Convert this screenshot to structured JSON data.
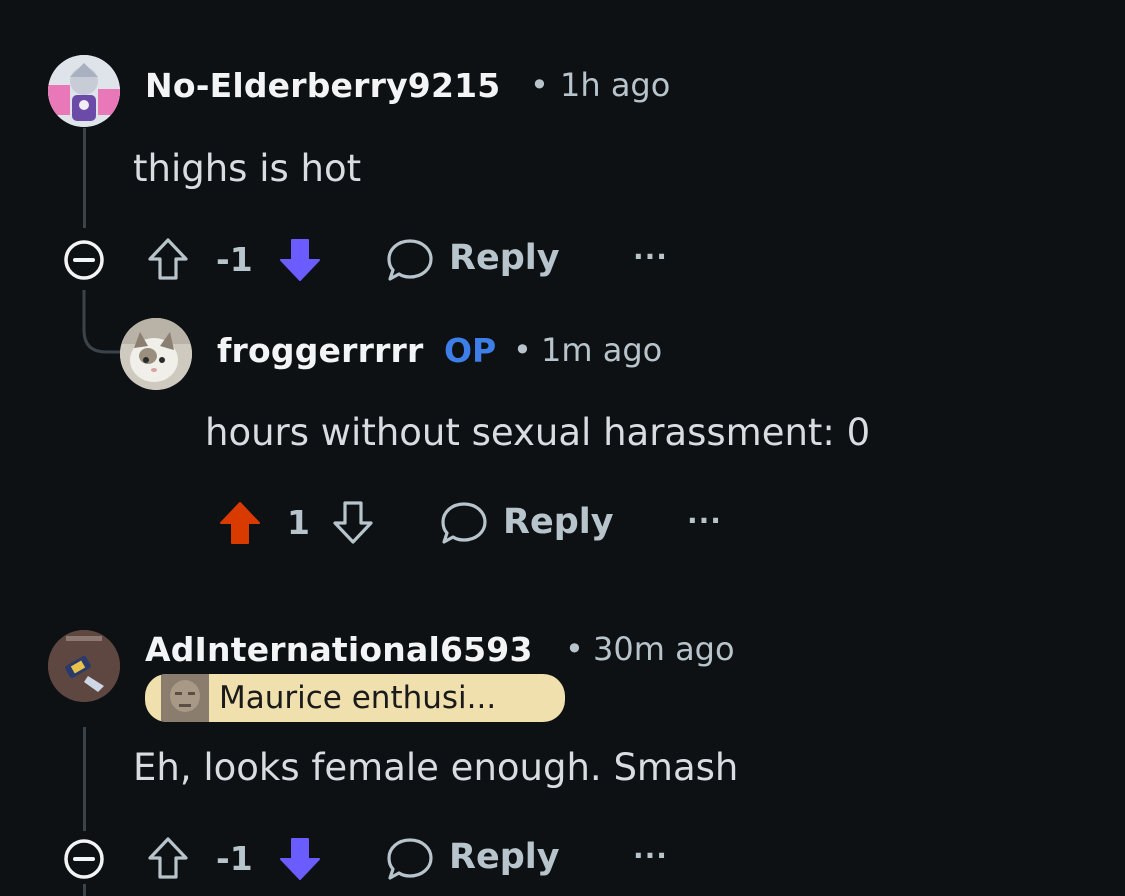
{
  "comments": [
    {
      "username": "No-Elderberry9215",
      "separator": "•",
      "time": "1h ago",
      "text": "thighs is hot",
      "score": "-1",
      "reply_label": "Reply",
      "more_label": "···",
      "vote_state": "downvoted"
    },
    {
      "username": "froggerrrrr",
      "op_badge": "OP",
      "separator": "•",
      "time": "1m ago",
      "text": "hours without sexual harassment: 0",
      "score": "1",
      "reply_label": "Reply",
      "more_label": "···",
      "vote_state": "upvoted"
    },
    {
      "username": "AdInternational6593",
      "separator": "•",
      "time": "30m ago",
      "flair": "Maurice enthusi...",
      "text": "Eh, looks female enough. Smash",
      "score": "-1",
      "reply_label": "Reply",
      "more_label": "···",
      "vote_state": "downvoted"
    }
  ],
  "colors": {
    "background": "#0e1113",
    "upvote_active": "#d93a00",
    "downvote_active": "#6a5cff",
    "op_badge": "#3d7ee8",
    "flair_bg": "#efe0ae",
    "muted_text": "#b8c4cc"
  },
  "icons": {
    "collapse": "minus-circle-icon",
    "upvote": "arrow-up-icon",
    "downvote": "arrow-down-icon",
    "reply": "speech-bubble-icon",
    "more": "ellipsis-icon"
  }
}
